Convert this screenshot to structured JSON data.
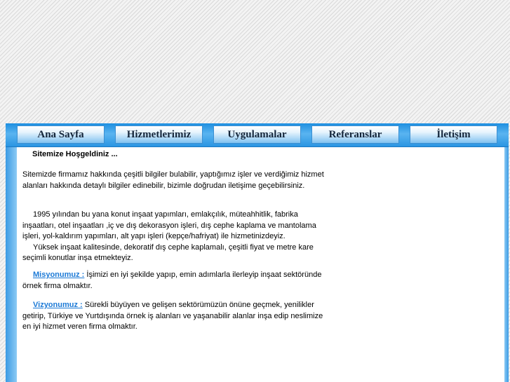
{
  "nav": {
    "items": [
      {
        "label": "Ana Sayfa"
      },
      {
        "label": "Hizmetlerimiz"
      },
      {
        "label": "Uygulamalar"
      },
      {
        "label": "Referanslar"
      },
      {
        "label": "İletişim"
      }
    ]
  },
  "content": {
    "welcome": "Sitemize Hoşgeldiniz ...",
    "intro": "Sitemizde firmamız hakkında çeşitli bilgiler bulabilir, yaptığımız işler ve verdiğimiz hizmet alanları hakkında detaylı bilgiler edinebilir, bizimle doğrudan iletişime geçebilirsiniz.",
    "history": "1995 yılından bu yana konut inşaat yapımları, emlakçılık, müteahhitlik, fabrika inşaatları, otel inşaatları ,iç ve dış dekorasyon işleri, dış cephe kaplama ve mantolama işleri, yol-kaldırım yapımları, alt yapı işleri (kepçe/hafriyat) ile hizmetinizdeyiz.",
    "quality": "Yüksek inşaat kalitesinde, dekoratif dış cephe kaplamalı, çeşitli fiyat ve metre kare seçimli konutlar inşa etmekteyiz.",
    "mission_label": "Misyonumuz :",
    "mission_text": " İşimizi en iyi şekilde yapıp, emin adımlarla ilerleyip inşaat sektöründe örnek firma olmaktır.",
    "vision_label": "Vizyonumuz :",
    "vision_text": " Sürekli büyüyen ve gelişen sektörümüzün önüne geçmek, yenilikler getirip, Türkiye ve Yurtdışında örnek iş   alanları ve yaşanabilir alanlar inşa edip neslimize en iyi hizmet veren firma olmaktır."
  },
  "colors": {
    "nav_bar": "#2a95e2",
    "link": "#1b79d6"
  }
}
